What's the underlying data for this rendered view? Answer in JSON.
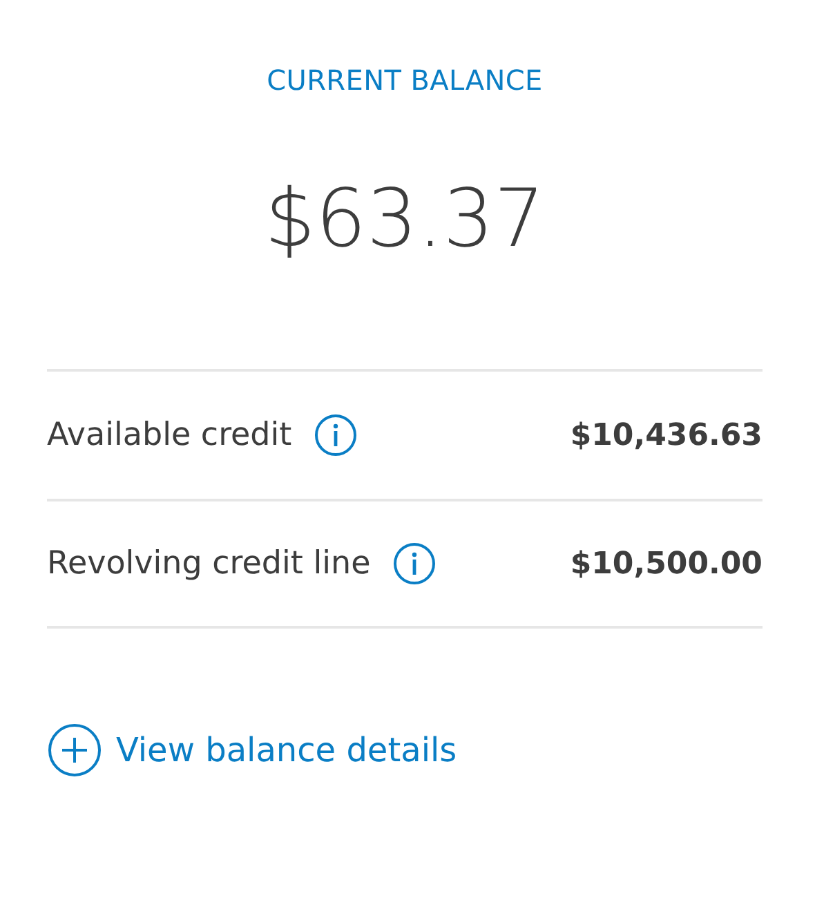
{
  "header": {
    "label": "CURRENT BALANCE"
  },
  "balance": "$63.37",
  "rows": [
    {
      "label": "Available credit",
      "value": "$10,436.63",
      "info": true
    },
    {
      "label": "Revolving credit line",
      "value": "$10,500.00",
      "info": true
    }
  ],
  "link": {
    "label": "View balance details"
  }
}
